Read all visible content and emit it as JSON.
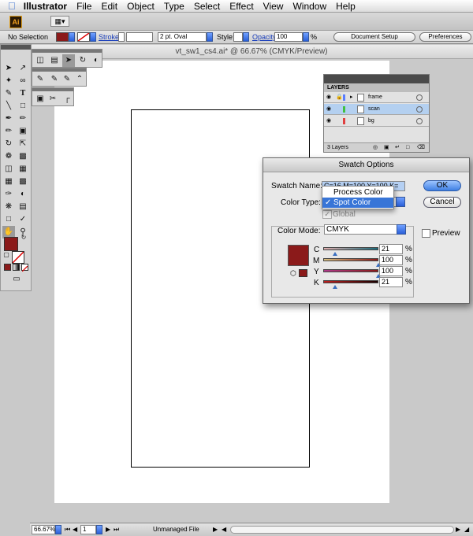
{
  "menubar": {
    "app_name": "Illustrator",
    "items": [
      "File",
      "Edit",
      "Object",
      "Type",
      "Select",
      "Effect",
      "View",
      "Window",
      "Help"
    ]
  },
  "appbar": {
    "logo": "Ai",
    "workspace_icon": "arrange-documents-icon"
  },
  "control_bar": {
    "selection": "No Selection",
    "fill_color": "#8b1a1a",
    "stroke_label": "Stroke:",
    "brush_value": "2 pt. Oval",
    "style_label": "Style:",
    "opacity_label": "Opacity:",
    "opacity_value": "100",
    "percent": "%",
    "document_setup": "Document Setup",
    "preferences": "Preferences"
  },
  "document": {
    "tab_title": "vt_sw1_cs4.ai* @ 66.67% (CMYK/Preview)"
  },
  "layers_panel": {
    "tab": "LAYERS",
    "layers": [
      {
        "name": "frame",
        "color": "#5a7dff"
      },
      {
        "name": "scan",
        "color": "#40c040"
      },
      {
        "name": "bg",
        "color": "#e04040"
      }
    ],
    "count": "3 Layers"
  },
  "dialog": {
    "title": "Swatch Options",
    "swatch_name_label": "Swatch Name:",
    "swatch_name_value": "C=16 M=100 Y=100 K=",
    "color_type_label": "Color Type:",
    "color_type_options": [
      "Process Color",
      "Spot Color"
    ],
    "color_type_selected": "Spot Color",
    "global_label": "Global",
    "color_mode_label": "Color Mode:",
    "color_mode_value": "CMYK",
    "ok": "OK",
    "cancel": "Cancel",
    "preview": "Preview",
    "swatch_color": "#8b1a1a",
    "channels": [
      {
        "label": "C",
        "value": "21",
        "level": 0.21
      },
      {
        "label": "M",
        "value": "100",
        "level": 1.0
      },
      {
        "label": "Y",
        "value": "100",
        "level": 1.0
      },
      {
        "label": "K",
        "value": "21",
        "level": 0.21
      }
    ],
    "percent": "%"
  },
  "status_bar": {
    "zoom": "66.67%",
    "page": "1",
    "status_text": "Unmanaged File"
  }
}
